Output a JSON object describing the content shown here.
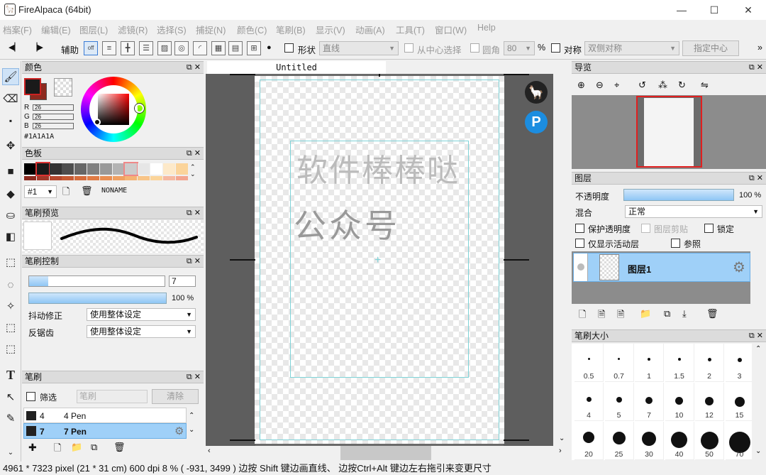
{
  "window": {
    "title": "FireAlpaca (64bit)",
    "minimize": "—",
    "maximize": "☐",
    "close": "✕"
  },
  "menu": [
    "档案(F)",
    "编辑(E)",
    "图层(L)",
    "滤镜(R)",
    "选择(S)",
    "捕捉(N)",
    "颜色(C)",
    "笔刷(B)",
    "显示(V)",
    "动画(A)",
    "工具(T)",
    "窗口(W)",
    "Help"
  ],
  "toolbar": {
    "assist_label": "辅助",
    "off_label": "off",
    "shape_label": "形状",
    "shape_value": "直线",
    "from_center_label": "从中心选择",
    "round_label": "圆角",
    "round_value": "80",
    "percent": "%",
    "symmetry_label": "对称",
    "symmetry_value": "双侧对称",
    "set_center_button": "指定中心",
    "more": "»"
  },
  "color_panel": {
    "title": "颜色",
    "r_label": "R",
    "r_value": "26",
    "g_label": "G",
    "g_value": "26",
    "b_label": "B",
    "b_value": "26",
    "hex": "#1A1A1A",
    "primary": "#1A1A1A",
    "secondary": "#8c2a1f"
  },
  "palette_panel": {
    "title": "色板",
    "preset": "#1",
    "name": "NONAME",
    "colors_top": [
      "#000000",
      "#1a1a1a",
      "#333333",
      "#4d4d4d",
      "#666666",
      "#808080",
      "#999999",
      "#b3b3b3",
      "#cccccc",
      "#e6e6e6",
      "#ffffff",
      "#fde9c9",
      "#fbd49a"
    ],
    "colors_bottom": [
      "#8c2a1f",
      "#a3382a",
      "#b5482e",
      "#c65a33",
      "#d46b3b",
      "#e07c45",
      "#e98e52",
      "#f0a061",
      "#f5b373",
      "#f8c487",
      "#fbd49a",
      "#f6b8a0",
      "#f3a58f"
    ]
  },
  "brush_preview": {
    "title": "笔刷预览"
  },
  "brush_control": {
    "title": "笔刷控制",
    "size_value": "7",
    "opacity_value": "100 %",
    "stabilizer_label": "抖动修正",
    "stabilizer_value": "使用整体设定",
    "antialias_label": "反锯齿",
    "antialias_value": "使用整体设定"
  },
  "brush_panel": {
    "title": "笔刷",
    "filter_label": "筛选",
    "filter_placeholder": "笔刷",
    "clear_button": "清除",
    "items": [
      {
        "size": "4",
        "name": "4 Pen"
      },
      {
        "size": "7",
        "name": "7 Pen"
      }
    ]
  },
  "canvas": {
    "tab_title": "Untitled",
    "text_line1": "软件棒棒哒",
    "text_line2": "公众号"
  },
  "navigator": {
    "title": "导览"
  },
  "layers": {
    "title": "图层",
    "opacity_label": "不透明度",
    "opacity_value": "100 %",
    "blend_label": "混合",
    "blend_value": "正常",
    "protect_alpha": "保护透明度",
    "clip": "图层剪贴",
    "lock": "锁定",
    "show_active": "仅显示活动层",
    "reference": "参照",
    "layer_name": "图层1"
  },
  "brush_size": {
    "title": "笔刷大小",
    "sizes": [
      "0.5",
      "0.7",
      "1",
      "1.5",
      "2",
      "3",
      "4",
      "5",
      "7",
      "10",
      "12",
      "15",
      "20",
      "25",
      "30",
      "40",
      "50",
      "70"
    ]
  },
  "status": {
    "text": "4961 * 7323 pixel   (21 * 31 cm)   600 dpi   8 %   ( -931, 3499 )   边按 Shift 键边画直线、 边按Ctrl+Alt 键边左右拖引来变更尺寸"
  },
  "panel_controls": "⧉ ✕"
}
